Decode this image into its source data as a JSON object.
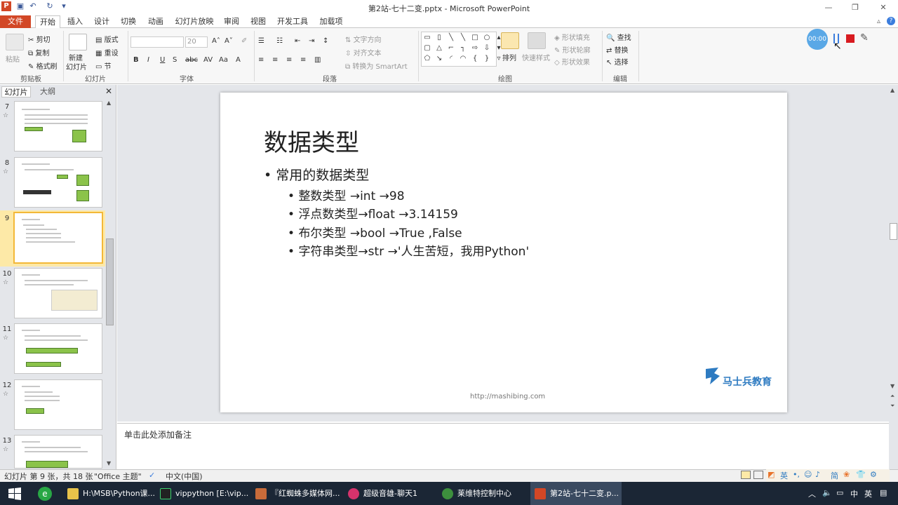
{
  "window": {
    "title": "第2站-七十二变.pptx - Microsoft PowerPoint",
    "minimize": "—",
    "maximize": "❐",
    "close": "✕"
  },
  "menu": {
    "file": "文件",
    "tabs": [
      "开始",
      "插入",
      "设计",
      "切换",
      "动画",
      "幻灯片放映",
      "审阅",
      "视图",
      "开发工具",
      "加载项"
    ]
  },
  "ribbon": {
    "clipboard": {
      "paste": "粘贴",
      "cut": "剪切",
      "copy": "复制",
      "format_painter": "格式刷",
      "label": "剪贴板"
    },
    "slides": {
      "new_slide": "新建",
      "new_slide2": "幻灯片",
      "layout": "版式",
      "reset": "重设",
      "section": "节",
      "label": "幻灯片"
    },
    "font": {
      "size": "20",
      "label": "字体"
    },
    "paragraph": {
      "text_direction": "文字方向",
      "align_text": "对齐文本",
      "convert_smartart": "转换为 SmartArt",
      "label": "段落"
    },
    "drawing": {
      "arrange": "排列",
      "quick_styles": "快速样式",
      "shape_fill": "形状填充",
      "shape_outline": "形状轮廓",
      "shape_effects": "形状效果",
      "label": "绘图"
    },
    "editing": {
      "find": "查找",
      "replace": "替换",
      "select": "选择",
      "label": "编辑"
    },
    "timer": "00:00"
  },
  "left_panel": {
    "tab_slides": "幻灯片",
    "tab_outline": "大纲",
    "close": "✕",
    "slide_numbers": [
      "7",
      "8",
      "9",
      "10",
      "11",
      "12",
      "13"
    ]
  },
  "slide": {
    "title": "数据类型",
    "bullet_main": "常用的数据类型",
    "sub_bullets": [
      "整数类型   →int   →98",
      "浮点数类型→float →3.14159",
      "布尔类型  →bool →True ,False",
      "字符串类型→str  →'人生苦短，我用Python'"
    ],
    "logo_text": "马士兵教育",
    "footer_url": "http://mashibing.com"
  },
  "notes": {
    "placeholder": "单击此处添加备注"
  },
  "status": {
    "slide_info": "幻灯片 第 9 张，共 18 张",
    "theme": "\"Office 主题\"",
    "language": "中文(中国)"
  },
  "taskbar": {
    "items": [
      "H:\\MSB\\Python课...",
      "vippython [E:\\vip...",
      "『红蜘蛛多媒体网...",
      "超级音雄-聊天1",
      "莱维特控制中心",
      "第2站-七十二变.p..."
    ],
    "ime": "英",
    "ime2": "简"
  },
  "colors": {
    "accent": "#d24726",
    "selected_thumb": "#f3b838",
    "taskbar": "#1b2635"
  }
}
